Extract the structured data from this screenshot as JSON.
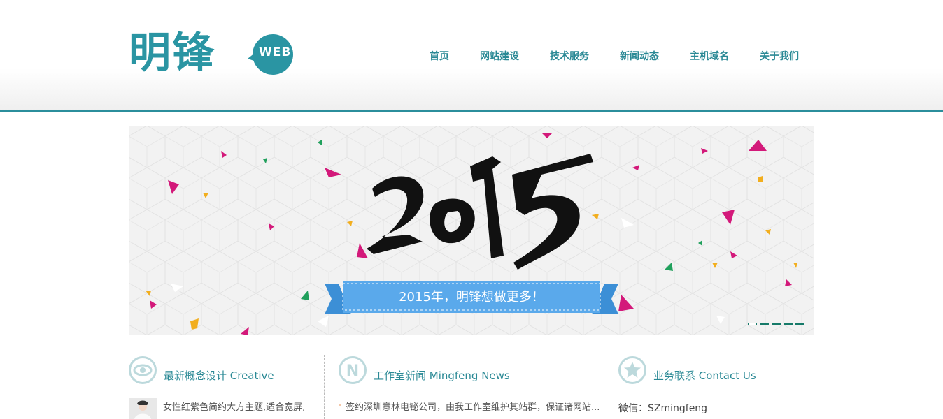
{
  "brand": {
    "logo_text": "明锋",
    "logo_badge": "WEB",
    "accent": "#2a95a3"
  },
  "nav": {
    "items": [
      {
        "label": "首页"
      },
      {
        "label": "网站建设"
      },
      {
        "label": "技术服务"
      },
      {
        "label": "新闻动态"
      },
      {
        "label": "主机域名"
      },
      {
        "label": "关于我们"
      }
    ]
  },
  "banner": {
    "headline": "2015",
    "ribbon_text": "2015年，明锋想做更多！",
    "slide_count": 5,
    "active_slide": 1
  },
  "columns": [
    {
      "icon": "eye-icon",
      "title": "最新概念设计 Creative",
      "item_text": "女性红紫色简约大方主题,适合宽屏,"
    },
    {
      "icon": "letter-n-icon",
      "title": "工作室新闻 Mingfeng News",
      "item_text": "签约深圳意林电铋公司，由我工作室维护其站群，保证诸网站..."
    },
    {
      "icon": "star-icon",
      "title": "业务联系 Contact Us",
      "item_text": "微信：SZmingfeng"
    }
  ]
}
